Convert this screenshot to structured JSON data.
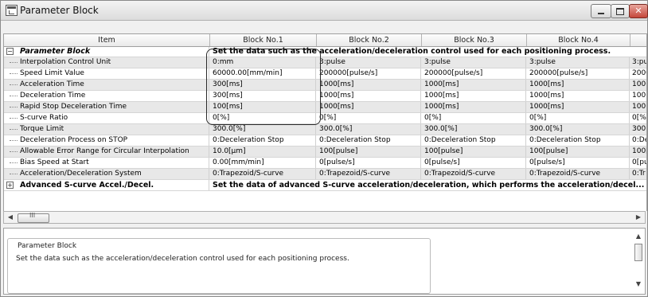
{
  "window": {
    "title": "Parameter Block"
  },
  "table": {
    "columns": [
      "Item",
      "Block No.1",
      "Block No.2",
      "Block No.3",
      "Block No.4"
    ],
    "rows": [
      {
        "type": "group",
        "expander": "−",
        "label": "Parameter Block",
        "span_text": "Set the data such as the acceleration/deceleration control used for each positioning process."
      },
      {
        "label": "Interpolation Control Unit",
        "values": [
          "0:mm",
          "3:pulse",
          "3:pulse",
          "3:pulse",
          "3:pu"
        ]
      },
      {
        "label": "Speed Limit Value",
        "values": [
          "60000.00[mm/min]",
          "200000[pulse/s]",
          "200000[pulse/s]",
          "200000[pulse/s]",
          "2000"
        ]
      },
      {
        "label": "Acceleration Time",
        "values": [
          "300[ms]",
          "1000[ms]",
          "1000[ms]",
          "1000[ms]",
          "100("
        ]
      },
      {
        "label": "Deceleration Time",
        "values": [
          "300[ms]",
          "1000[ms]",
          "1000[ms]",
          "1000[ms]",
          "100("
        ]
      },
      {
        "label": "Rapid Stop Deceleration Time",
        "values": [
          "100[ms]",
          "1000[ms]",
          "1000[ms]",
          "1000[ms]",
          "100("
        ]
      },
      {
        "label": "S-curve Ratio",
        "values": [
          "0[%]",
          "0[%]",
          "0[%]",
          "0[%]",
          "0[%"
        ]
      },
      {
        "label": "Torque Limit",
        "values": [
          "300.0[%]",
          "300.0[%]",
          "300.0[%]",
          "300.0[%]",
          "300."
        ]
      },
      {
        "label": "Deceleration Process on STOP",
        "values": [
          "0:Deceleration Stop",
          "0:Deceleration Stop",
          "0:Deceleration Stop",
          "0:Deceleration Stop",
          "0:De"
        ]
      },
      {
        "label": "Allowable Error Range for Circular Interpolation",
        "values": [
          "10.0[µm]",
          "100[pulse]",
          "100[pulse]",
          "100[pulse]",
          "100["
        ]
      },
      {
        "label": "Bias Speed at Start",
        "values": [
          "0.00[mm/min]",
          "0[pulse/s]",
          "0[pulse/s]",
          "0[pulse/s]",
          "0[pu"
        ]
      },
      {
        "label": "Acceleration/Deceleration System",
        "values": [
          "0:Trapezoid/S-curve",
          "0:Trapezoid/S-curve",
          "0:Trapezoid/S-curve",
          "0:Trapezoid/S-curve",
          "0:Tr"
        ]
      },
      {
        "type": "group",
        "expander": "+",
        "label": "Advanced S-curve Accel./Decel.",
        "span_text": "Set the data of advanced S-curve acceleration/deceleration, which performs the acceleration/decel..."
      }
    ]
  },
  "scrollbar": {
    "thumb_glyph": "III"
  },
  "description": {
    "group_title": "Parameter Block",
    "text": "Set the data such as the acceleration/deceleration control used for each positioning process."
  },
  "colors": {
    "row_alt": "#e8e8e8",
    "window_bg": "#f0f0f0"
  }
}
